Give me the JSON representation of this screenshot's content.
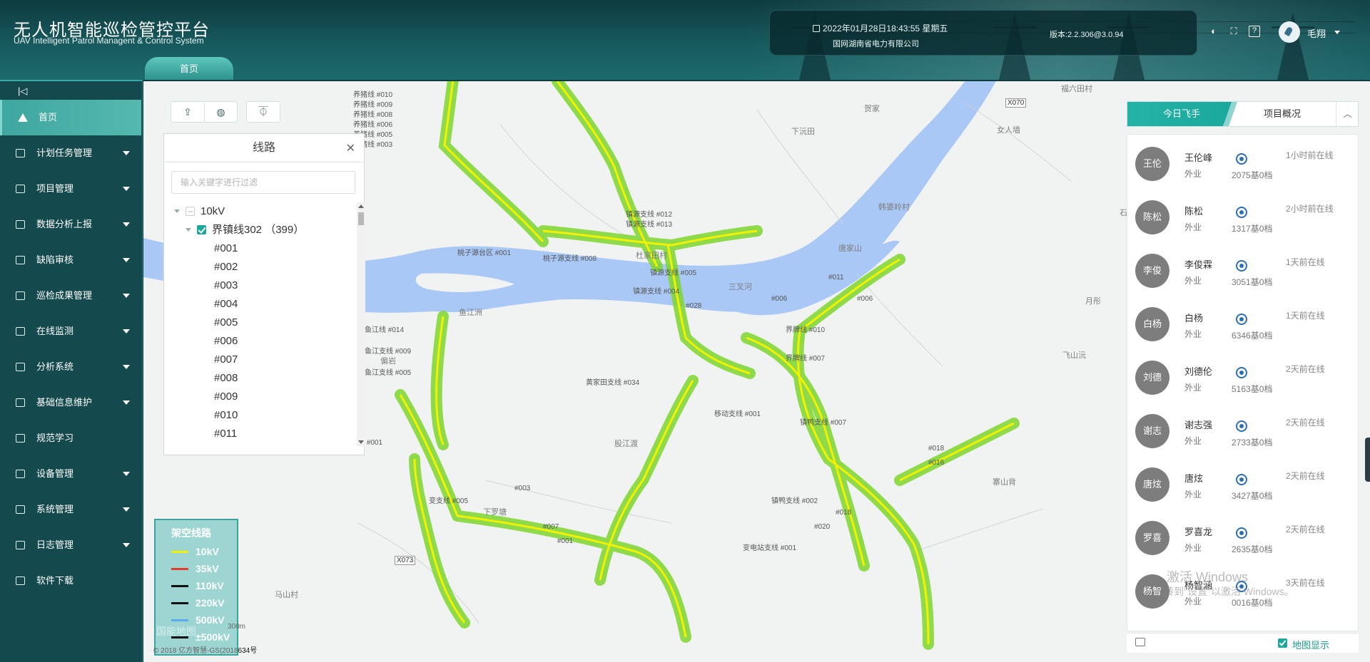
{
  "header": {
    "title": "无人机智能巡检管控平台",
    "subtitle": "UAV Intelligent Patrol Managent & Control System",
    "datetime": "2022年01月28日18:43:55 星期五",
    "company": "国网湖南省电力有限公司",
    "version": "版本:2.2.306@3.0.94",
    "username": "毛翔",
    "home_tab": "首页"
  },
  "sidebar": {
    "items": [
      {
        "label": "首页",
        "active": true,
        "icon": "home-icon"
      },
      {
        "label": "计划任务管理",
        "caret": true,
        "icon": "calendar-icon"
      },
      {
        "label": "项目管理",
        "caret": true,
        "icon": "project-icon"
      },
      {
        "label": "数据分析上报",
        "caret": true,
        "icon": "report-icon"
      },
      {
        "label": "缺陷审核",
        "caret": true,
        "icon": "user-icon"
      },
      {
        "label": "巡检成果管理",
        "caret": true,
        "icon": "folder-icon"
      },
      {
        "label": "在线监测",
        "caret": true,
        "icon": "monitor-icon"
      },
      {
        "label": "分析系统",
        "caret": true,
        "icon": "chart-icon"
      },
      {
        "label": "基础信息维护",
        "caret": true,
        "icon": "layers-icon"
      },
      {
        "label": "规范学习",
        "caret": false,
        "icon": "book-icon"
      },
      {
        "label": "设备管理",
        "caret": true,
        "icon": "device-icon"
      },
      {
        "label": "系统管理",
        "caret": true,
        "icon": "system-icon"
      },
      {
        "label": "日志管理",
        "caret": true,
        "icon": "log-icon"
      },
      {
        "label": "软件下载",
        "caret": false,
        "icon": "download-icon"
      }
    ]
  },
  "line_panel": {
    "title": "线路",
    "filter_placeholder": "输入关键字进行过滤",
    "root": "10kV",
    "line": "界镇线302 （399）",
    "nodes": [
      "#001",
      "#002",
      "#003",
      "#004",
      "#005",
      "#006",
      "#007",
      "#008",
      "#009",
      "#010",
      "#011"
    ]
  },
  "legend": {
    "title": "架空线路",
    "items": [
      {
        "label": "10kV",
        "color": "#f2f200"
      },
      {
        "label": "35kV",
        "color": "#e53b2c"
      },
      {
        "label": "110kV",
        "color": "#111111"
      },
      {
        "label": "220kV",
        "color": "#111111"
      },
      {
        "label": "500kV",
        "color": "#5aaaf0"
      },
      {
        "label": "±500kV",
        "color": "#111111"
      }
    ]
  },
  "map": {
    "places": [
      "福六田村",
      "贺家",
      "下沅田",
      "女人墙",
      "杜家田村",
      "三叉河",
      "唐家山",
      "韩婆岭村",
      "鱼江洲",
      "偏岩",
      "股江渡",
      "飞山沅",
      "月彤",
      "下罗塘",
      "马山村",
      "寨山背",
      "X070",
      "X073",
      "石"
    ],
    "scale": "300m",
    "copyright": "© 2018 亿方智慧-GS(2018",
    "copyright_num": "634号",
    "copyright_faded": "国能地图"
  },
  "right_panel": {
    "tab_active": "今日飞手",
    "tab_other": "项目概况",
    "pilots": [
      {
        "avatar": "王伦",
        "name": "王伦峰",
        "type": "外业",
        "count": "2075基0档",
        "status": "1小时前在线"
      },
      {
        "avatar": "陈松",
        "name": "陈松",
        "type": "外业",
        "count": "1317基0档",
        "status": "2小时前在线"
      },
      {
        "avatar": "李俊",
        "name": "李俊霖",
        "type": "外业",
        "count": "3051基0档",
        "status": "1天前在线"
      },
      {
        "avatar": "白杨",
        "name": "白杨",
        "type": "外业",
        "count": "6346基0档",
        "status": "1天前在线"
      },
      {
        "avatar": "刘德",
        "name": "刘德伦",
        "type": "外业",
        "count": "5163基0档",
        "status": "2天前在线"
      },
      {
        "avatar": "谢志",
        "name": "谢志强",
        "type": "外业",
        "count": "2733基0档",
        "status": "2天前在线"
      },
      {
        "avatar": "唐炫",
        "name": "唐炫",
        "type": "外业",
        "count": "3427基0档",
        "status": "2天前在线"
      },
      {
        "avatar": "罗喜",
        "name": "罗喜龙",
        "type": "外业",
        "count": "2635基0档",
        "status": "2天前在线"
      },
      {
        "avatar": "杨智",
        "name": "杨智涵",
        "type": "外业",
        "count": "0016基0档",
        "status": "3天前在线"
      }
    ],
    "map_display": "地图显示"
  },
  "watermark": {
    "line1": "激活 Windows",
    "line2": "转到\"设置\"以激活 Windows。"
  }
}
